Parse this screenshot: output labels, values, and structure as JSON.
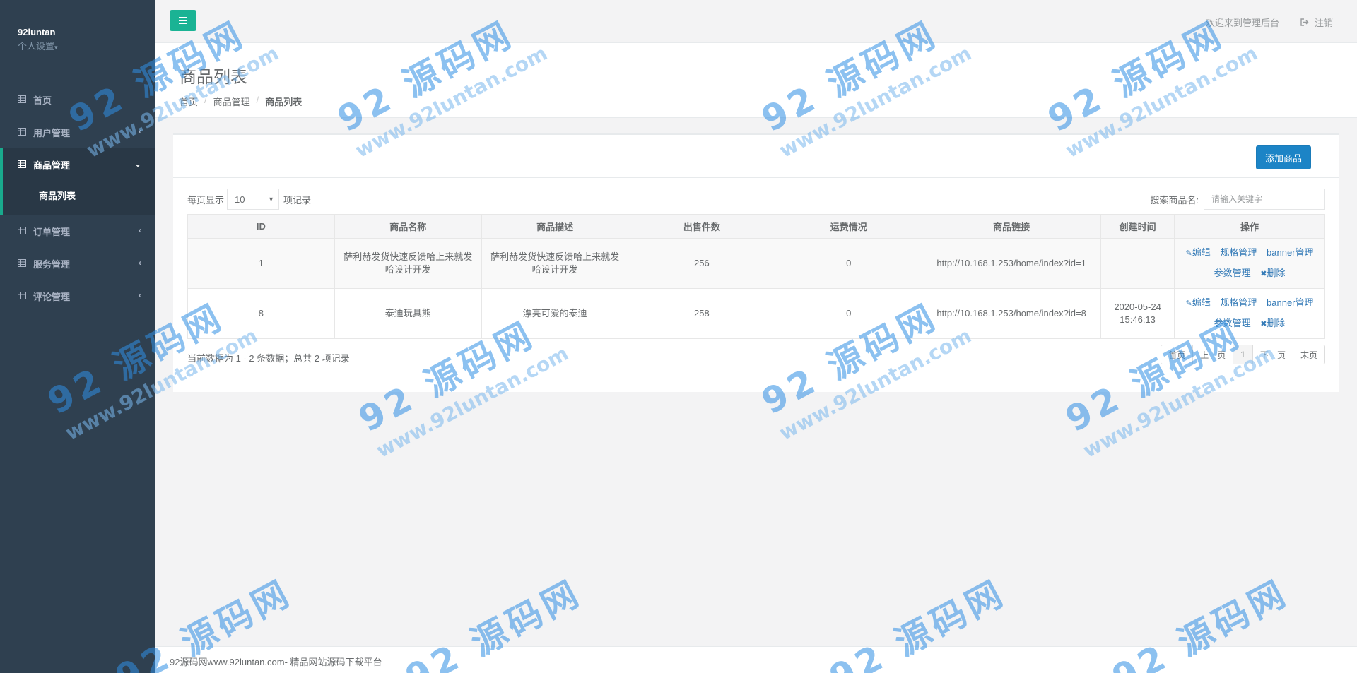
{
  "sidebar": {
    "user_name": "92luntan",
    "settings_label": "个人设置",
    "items": [
      {
        "label": "首页"
      },
      {
        "label": "用户管理"
      },
      {
        "label": "商品管理",
        "sub": [
          "商品列表"
        ]
      },
      {
        "label": "订单管理"
      },
      {
        "label": "服务管理"
      },
      {
        "label": "评论管理"
      }
    ]
  },
  "topbar": {
    "welcome": "欢迎来到管理后台",
    "logout": "注销"
  },
  "page": {
    "title": "商品列表",
    "breadcrumb": [
      "首页",
      "商品管理",
      "商品列表"
    ]
  },
  "toolbar": {
    "add_button": "添加商品",
    "page_size_prefix": "每页显示",
    "page_size_value": "10",
    "page_size_suffix": "项记录",
    "search_label": "搜索商品名:",
    "search_placeholder": "请输入关键字"
  },
  "table": {
    "columns": [
      "ID",
      "商品名称",
      "商品描述",
      "出售件数",
      "运费情况",
      "商品链接",
      "创建时间",
      "操作"
    ],
    "rows": [
      {
        "id": "1",
        "name": "萨利赫发货快速反馈哈上来就发哈设计开发",
        "desc": "萨利赫发货快速反馈哈上来就发哈设计开发",
        "sold": "256",
        "shipping": "0",
        "link": "http://10.168.1.253/home/index?id=1",
        "created": ""
      },
      {
        "id": "8",
        "name": "泰迪玩具熊",
        "desc": "漂亮可爱的泰迪",
        "sold": "258",
        "shipping": "0",
        "link": "http://10.168.1.253/home/index?id=8",
        "created": "2020-05-24 15:46:13"
      }
    ],
    "actions": {
      "edit": "编辑",
      "spec": "规格管理",
      "banner": "banner管理",
      "params": "参数管理",
      "delete": "删除"
    }
  },
  "pagination": {
    "info": "当前数据为 1 - 2 条数据；总共 2 项记录",
    "first": "首页",
    "prev": "上一页",
    "current": "1",
    "next": "下一页",
    "last": "末页"
  },
  "footer": {
    "text": "92源码网www.92luntan.com- 精品网站源码下载平台"
  },
  "watermark": {
    "title": "92 源码网",
    "url": "www.92luntan.com"
  },
  "colors": {
    "sidebar_bg": "#2f4050",
    "accent": "#1ab394",
    "primary_button": "#1c84c6",
    "link": "#337ab7"
  }
}
